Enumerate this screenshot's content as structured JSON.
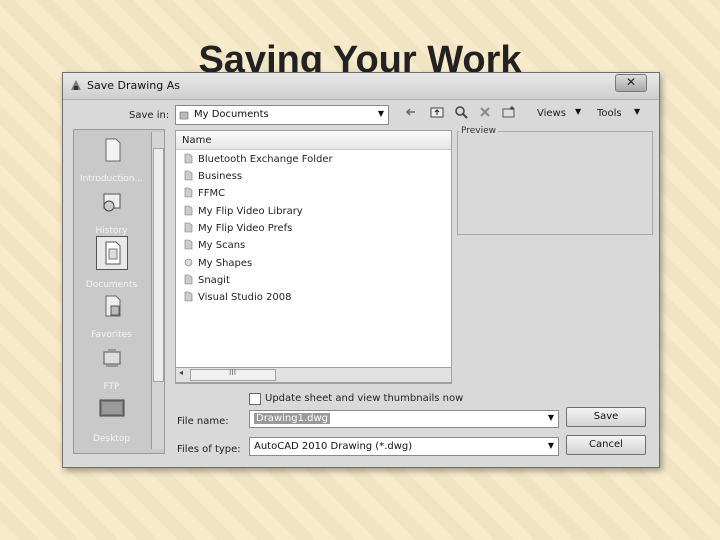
{
  "slide": {
    "title": "Saving Your Work"
  },
  "dialog": {
    "title": "Save Drawing As",
    "close_label": "✕",
    "save_in_label": "Save in:",
    "save_in_value": "My Documents",
    "toolbar": {
      "views_label": "Views",
      "tools_label": "Tools"
    },
    "places": [
      {
        "label": "Introduction...",
        "icon": "document-icon"
      },
      {
        "label": "History",
        "icon": "history-icon"
      },
      {
        "label": "Documents",
        "icon": "documents-icon"
      },
      {
        "label": "Favorites",
        "icon": "favorites-icon"
      },
      {
        "label": "FTP",
        "icon": "ftp-icon"
      },
      {
        "label": "Desktop",
        "icon": "desktop-icon"
      }
    ],
    "file_list": {
      "column_header": "Name",
      "items": [
        {
          "name": "Bluetooth Exchange Folder",
          "icon": "folder-icon"
        },
        {
          "name": "Business",
          "icon": "folder-icon"
        },
        {
          "name": "FFMC",
          "icon": "folder-icon"
        },
        {
          "name": "My Flip Video Library",
          "icon": "folder-icon"
        },
        {
          "name": "My Flip Video Prefs",
          "icon": "folder-icon"
        },
        {
          "name": "My Scans",
          "icon": "folder-icon"
        },
        {
          "name": "My Shapes",
          "icon": "shapes-folder-icon"
        },
        {
          "name": "Snagit",
          "icon": "folder-icon"
        },
        {
          "name": "Visual Studio 2008",
          "icon": "folder-icon"
        }
      ],
      "hscroll_grip": "III"
    },
    "preview_label": "Preview",
    "update_thumbnails_label": "Update sheet and view thumbnails now",
    "file_name_label": "File name:",
    "file_name_value": "Drawing1.dwg",
    "file_type_label": "Files of type:",
    "file_type_value": "AutoCAD 2010 Drawing (*.dwg)",
    "save_button": "Save",
    "cancel_button": "Cancel"
  }
}
